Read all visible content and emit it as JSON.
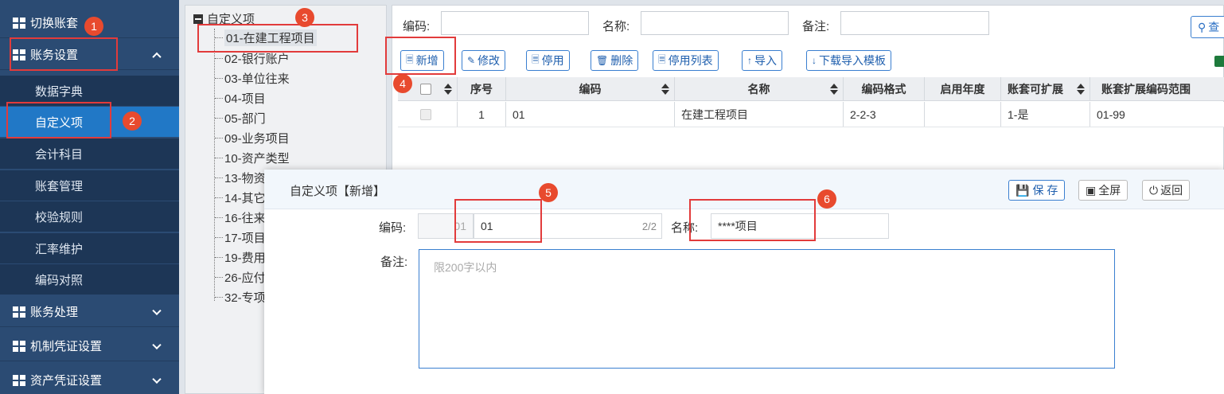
{
  "sidebar": {
    "switch_account": "切换账套",
    "account_settings": "账务设置",
    "sub_items": [
      "数据字典",
      "自定义项",
      "会计科目",
      "账套管理",
      "校验规则",
      "汇率维护",
      "编码对照"
    ],
    "account_processing": "账务处理",
    "voucher_settings": "机制凭证设置",
    "asset_voucher_settings": "资产凭证设置"
  },
  "tree": {
    "root": "自定义项",
    "nodes": [
      "01-在建工程项目",
      "02-银行账户",
      "03-单位往来",
      "04-项目",
      "05-部门",
      "09-业务项目",
      "10-资产类型",
      "13-物资",
      "14-其它",
      "16-往来",
      "17-项目",
      "19-费用",
      "26-应付",
      "32-专项"
    ]
  },
  "filter": {
    "code_label": "编码:",
    "name_label": "名称:",
    "remark_label": "备注:",
    "query_button": "查"
  },
  "toolbar": {
    "add": "新增",
    "disable": "停用",
    "delete": "删除",
    "modify": "修改",
    "disabled_list": "停用列表",
    "import": "导入",
    "download_template": "下载导入模板"
  },
  "grid": {
    "headers": [
      "序号",
      "编码",
      "名称",
      "编码格式",
      "启用年度",
      "账套可扩展",
      "账套扩展编码范围"
    ],
    "rows": [
      {
        "seq": "1",
        "code": "01",
        "name": "在建工程项目",
        "format": "2-2-3",
        "year": "",
        "extendable": "1-是",
        "range": "01-99"
      }
    ]
  },
  "dialog": {
    "title": "自定义项【新增】",
    "save": "保 存",
    "fullscreen": "全屏",
    "back": "返回",
    "code_label": "编码:",
    "code_prefix": "01",
    "code_value": "01",
    "code_count": "2/2",
    "name_label": "名称:",
    "name_value": "****项目",
    "remark_label": "备注:",
    "remark_placeholder": "限200字以内"
  },
  "badges": [
    "1",
    "2",
    "3",
    "4",
    "5",
    "6"
  ],
  "colors": {
    "sidebar": "#2b4b73",
    "active": "#2178c6",
    "accent": "#3a7fd0",
    "annotation": "#e23b3b"
  }
}
